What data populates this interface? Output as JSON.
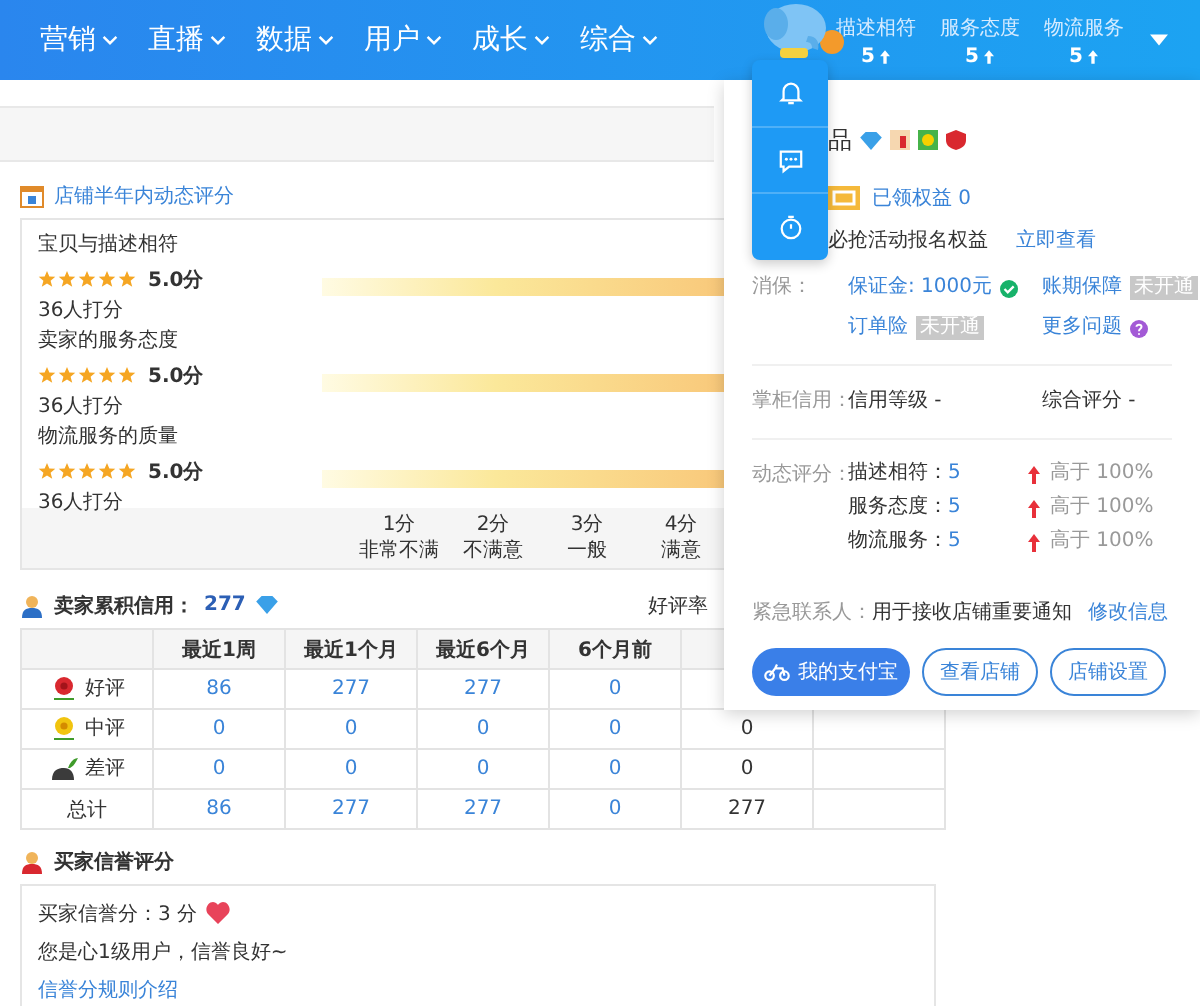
{
  "nav": {
    "items": [
      {
        "label": "营销"
      },
      {
        "label": "直播"
      },
      {
        "label": "数据"
      },
      {
        "label": "用户"
      },
      {
        "label": "成长"
      },
      {
        "label": "综合"
      }
    ],
    "scores": [
      {
        "label": "描述相符",
        "value": "5"
      },
      {
        "label": "服务态度",
        "value": "5"
      },
      {
        "label": "物流服务",
        "value": "5"
      }
    ]
  },
  "rating": {
    "title": "店铺半年内动态评分",
    "items": [
      {
        "label": "宝贝与描述相符",
        "stars": 5,
        "score": "5.0分",
        "count": "36人打分"
      },
      {
        "label": "卖家的服务态度",
        "stars": 5,
        "score": "5.0分",
        "count": "36人打分"
      },
      {
        "label": "物流服务的质量",
        "stars": 5,
        "score": "5.0分",
        "count": "36人打分"
      }
    ],
    "scale": [
      {
        "score": "1分",
        "label": "非常不满"
      },
      {
        "score": "2分",
        "label": "不满意"
      },
      {
        "score": "3分",
        "label": "一般"
      },
      {
        "score": "4分",
        "label": "满意"
      }
    ]
  },
  "seller_credit": {
    "title": "卖家累积信用：",
    "value": "277",
    "rate_label": "好评率",
    "columns": [
      "最近1周",
      "最近1个月",
      "最近6个月",
      "6个月前"
    ],
    "rows": [
      {
        "kind": "good",
        "label": "好评",
        "cells": [
          "86",
          "277",
          "277",
          "0"
        ]
      },
      {
        "kind": "neutral",
        "label": "中评",
        "cells": [
          "0",
          "0",
          "0",
          "0",
          "0"
        ]
      },
      {
        "kind": "bad",
        "label": "差评",
        "cells": [
          "0",
          "0",
          "0",
          "0",
          "0"
        ]
      },
      {
        "kind": "total",
        "label": "总计",
        "cells": [
          "86",
          "277",
          "277",
          "0",
          "277"
        ]
      }
    ]
  },
  "buyer_credit": {
    "title": "买家信誉评分",
    "score": "买家信誉分：3 分",
    "message": "您是心1级用户，信誉良好~",
    "link": "信誉分规则介绍"
  },
  "shop_panel": {
    "name": "品",
    "benefits": "已领权益 0",
    "promo": "必抢活动报名权益",
    "promo_link": "立即查看",
    "protection": {
      "label": "消保：",
      "items": [
        {
          "text": "保证金: 1000元",
          "kind": "verified"
        },
        {
          "text": "账期保障",
          "kind": "tag",
          "tag": "未开通"
        },
        {
          "text": "订单险",
          "kind": "tag",
          "tag": "未开通"
        },
        {
          "text": "更多问题",
          "kind": "help"
        }
      ]
    },
    "credit": {
      "label": "掌柜信用：",
      "items": [
        "信用等级 -",
        "综合评分 -"
      ]
    },
    "dynamic": {
      "label": "动态评分：",
      "items": [
        {
          "name": "描述相符：",
          "value": "5",
          "compare": "高于 100%"
        },
        {
          "name": "服务态度：",
          "value": "5",
          "compare": "高于 100%"
        },
        {
          "name": "物流服务：",
          "value": "5",
          "compare": "高于 100%"
        }
      ]
    },
    "contact": {
      "label": "紧急联系人：",
      "text": "用于接收店铺重要通知",
      "link": "修改信息"
    },
    "buttons": [
      {
        "label": "我的支付宝",
        "kind": "primary"
      },
      {
        "label": "查看店铺",
        "kind": "outline"
      },
      {
        "label": "店铺设置",
        "kind": "outline"
      }
    ]
  },
  "toolbar": [
    {
      "kind": "bell"
    },
    {
      "kind": "chat"
    },
    {
      "kind": "timer"
    }
  ]
}
